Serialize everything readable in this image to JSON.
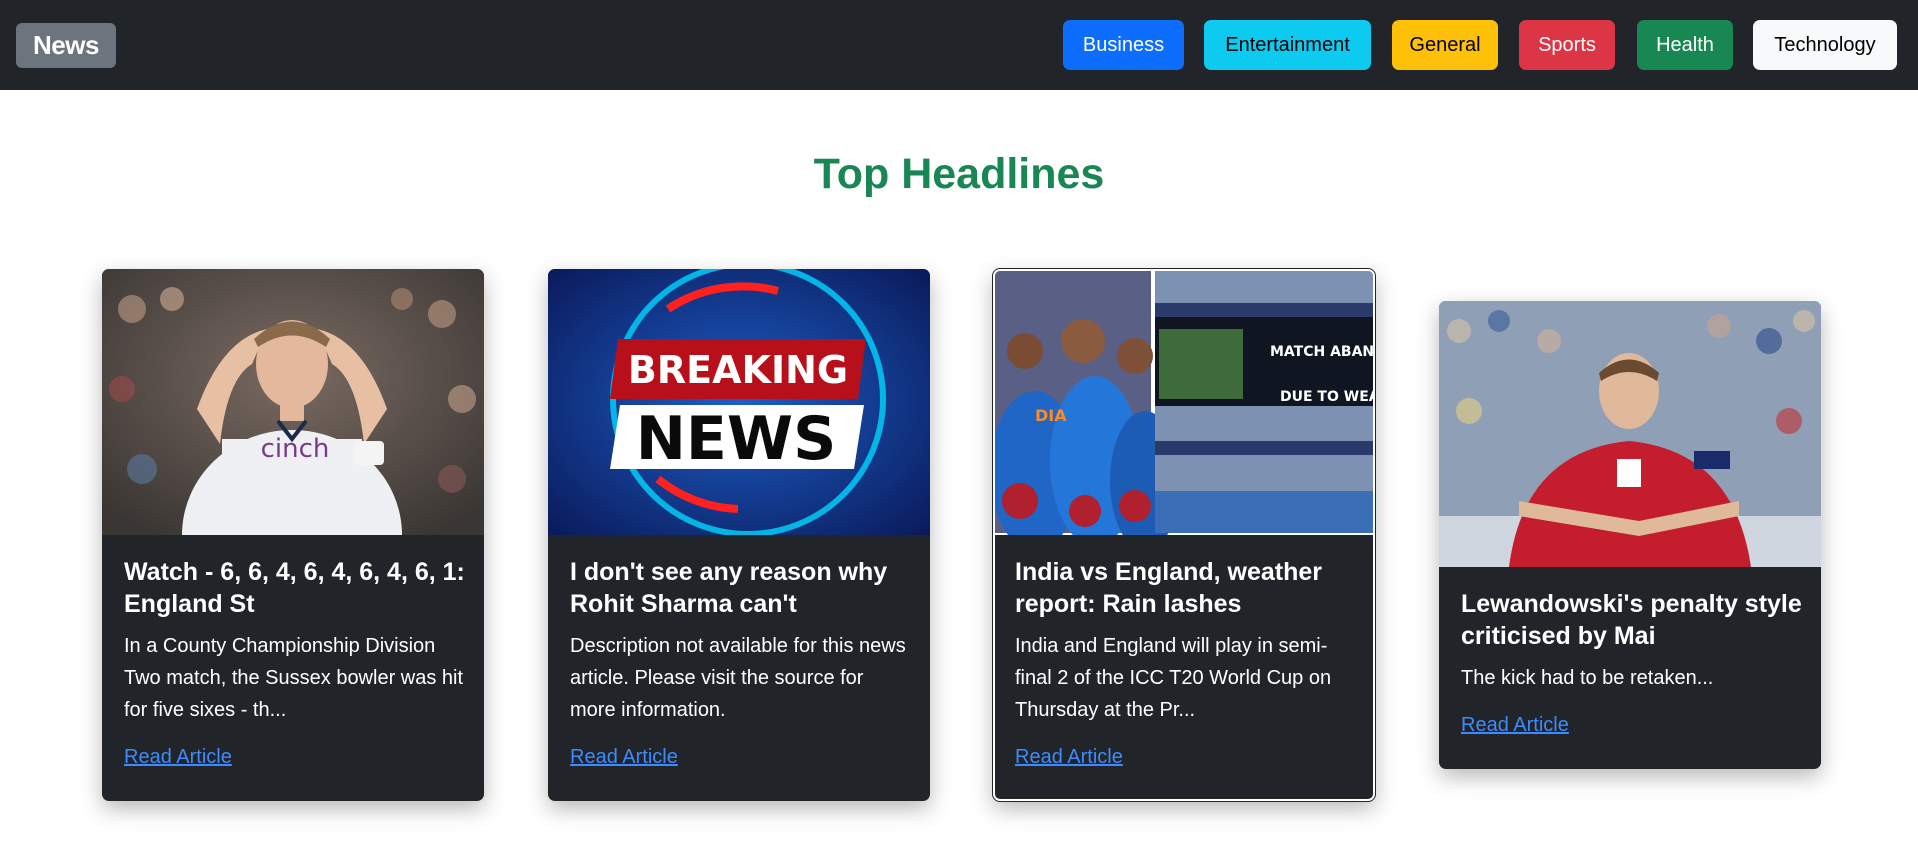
{
  "navbar": {
    "brand": "News",
    "categories": {
      "business": "Business",
      "entertainment": "Entertainment",
      "general": "General",
      "sports": "Sports",
      "health": "Health",
      "technology": "Technology"
    }
  },
  "main": {
    "heading": "Top Headlines",
    "articles": [
      {
        "title": "Watch - 6, 6, 4, 6, 4, 6, 4, 6, 1: England St",
        "description": "In a County Championship Division Two match, the Sussex bowler was hit for five sixes - th...",
        "link": "Read Article"
      },
      {
        "title": "I don't see any reason why Rohit Sharma can't",
        "description": "Description not available for this news article. Please visit the source for more information.",
        "link": "Read Article",
        "image_text_top": "BREAKING",
        "image_text_bottom": "NEWS"
      },
      {
        "title": "India vs England, weather report: Rain lashes",
        "description": "India and England will play in semi-final 2 of the ICC T20 World Cup on Thursday at the Pr...",
        "link": "Read Article",
        "image_text_line1": "MATCH ABAND",
        "image_text_line2": "DUE TO WEAT"
      },
      {
        "title": "Lewandowski's penalty style criticised by Mai",
        "description": "The kick had to be retaken...",
        "link": "Read Article"
      }
    ]
  },
  "colors": {
    "navbar_bg": "#212529",
    "heading": "#198754",
    "link": "#3d8bfd"
  }
}
